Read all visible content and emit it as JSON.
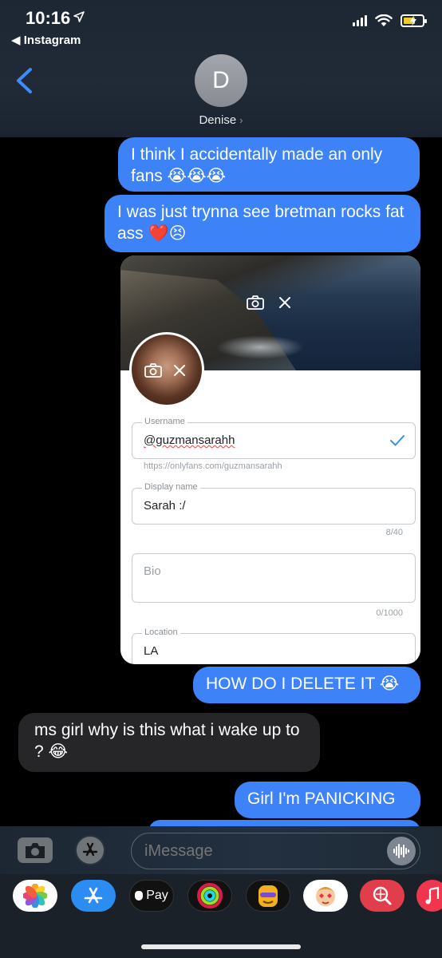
{
  "status": {
    "time": "10:16",
    "back_app": "◀ Instagram"
  },
  "header": {
    "avatar_initial": "D",
    "contact_name": "Denise",
    "chevron": "›"
  },
  "messages": [
    {
      "from": "me",
      "text": "I think I accidentally made an only fans 😭😭😭"
    },
    {
      "from": "me",
      "text": "I was just trynna see bretman rocks fat ass ❤️😣"
    },
    {
      "from": "me",
      "text": "HOW DO I DELETE IT 😭"
    },
    {
      "from": "them",
      "text": "ms girl why is this what i wake up to ? 😂"
    },
    {
      "from": "me",
      "text": "Girl I'm PANICKING"
    }
  ],
  "attachment": {
    "username_label": "Username",
    "username_value": "@guzmansarahh",
    "profile_url": "https://onlyfans.com/guzmansarahh",
    "display_name_label": "Display name",
    "display_name_value": "Sarah :/",
    "display_name_count": "8/40",
    "bio_placeholder": "Bio",
    "bio_count": "0/1000",
    "location_label": "Location",
    "location_value": "LA"
  },
  "composer": {
    "placeholder": "iMessage"
  },
  "app_drawer": {
    "apple_pay_label": "Pay"
  },
  "colors": {
    "sent_bubble": "#3e82f7",
    "received_bubble": "#262628",
    "accent_check": "#3a8fdc"
  },
  "icons": [
    "location-arrow-icon",
    "signal-icon",
    "wifi-icon",
    "battery-icon",
    "back-chevron-icon",
    "camera-icon",
    "close-icon",
    "checkmark-icon",
    "app-store-icon",
    "audio-waveform-icon"
  ]
}
